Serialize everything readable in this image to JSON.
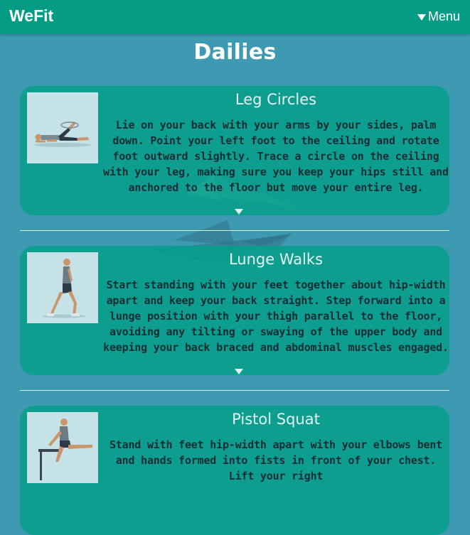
{
  "app": {
    "brand": "WeFit",
    "menu_label": "Menu"
  },
  "page": {
    "title": "Dailies"
  },
  "exercises": [
    {
      "title": "Leg Circles",
      "description": "Lie on your back with your arms by your sides, palm down. Point your left foot to the ceiling and rotate foot outward slightly. Trace a circle on the ceiling with your leg, making sure you keep your hips still and anchored to the floor but move your entire leg.",
      "image_icon": "leg-circles-figure"
    },
    {
      "title": "Lunge Walks",
      "description": "Start standing with your feet together about hip-width apart and keep your back straight. Step forward into a lunge position with your thigh parallel to the floor, avoiding any tilting or swaying of the upper body and keeping your back braced and abdominal muscles engaged.",
      "image_icon": "lunge-walks-figure"
    },
    {
      "title": "Pistol Squat",
      "description": "Stand with feet hip-width apart with your elbows bent and hands formed into fists in front of your chest. Lift your right",
      "image_icon": "pistol-squat-figure"
    }
  ],
  "colors": {
    "header": "#059c86",
    "background": "#3e9ab1",
    "card": "#069e8a",
    "description_text": "#122d33"
  }
}
